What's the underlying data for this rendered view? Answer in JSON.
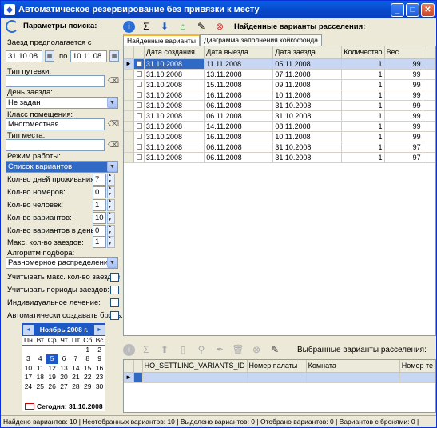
{
  "window": {
    "title": "Автоматическое резервирование без привязки к месту"
  },
  "left": {
    "header": "Параметры поиска:",
    "arrival_label": "Заезд предполагается с",
    "date_from": "31.10.08",
    "po_label": "по",
    "date_to": "10.11.08",
    "voucher_label": "Тип путевки:",
    "voucher_value": "",
    "arrival_day_label": "День заезда:",
    "arrival_day_value": "Не задан",
    "room_class_label": "Класс помещения:",
    "room_class_value": "Многоместная",
    "place_type_label": "Тип места:",
    "place_type_value": "",
    "mode_label": "Режим работы:",
    "mode_value": "Список вариантов",
    "params": [
      {
        "label": "Кол-во дней проживания:",
        "value": "7"
      },
      {
        "label": "Кол-во номеров:",
        "value": "0"
      },
      {
        "label": "Кол-во человек:",
        "value": "1"
      },
      {
        "label": "Кол-во вариантов:",
        "value": "10"
      },
      {
        "label": "Кол-во вариантов в день:",
        "value": "0"
      },
      {
        "label": "Макс. кол-во заездов:",
        "value": "1"
      }
    ],
    "algo_label": "Алгоритм подбора:",
    "algo_value": "Равномерное распределение",
    "checkboxes": [
      "Учитывать макс. кол-во заездов:",
      "Учитывать периоды заездов:",
      "Индивидуальное лечение:",
      "Автоматически создавать бронь:"
    ]
  },
  "calendar": {
    "month": "Ноябрь 2008 г.",
    "dow": [
      "Пн",
      "Вт",
      "Ср",
      "Чт",
      "Пт",
      "Сб",
      "Вс"
    ],
    "days": [
      "",
      "",
      "",
      "",
      "",
      "1",
      "2",
      "3",
      "4",
      "5",
      "6",
      "7",
      "8",
      "9",
      "10",
      "11",
      "12",
      "13",
      "14",
      "15",
      "16",
      "17",
      "18",
      "19",
      "20",
      "21",
      "22",
      "23",
      "24",
      "25",
      "26",
      "27",
      "28",
      "29",
      "30",
      "",
      "",
      "",
      "",
      "",
      "",
      ""
    ],
    "today_label": "Сегодня: 31.10.2008"
  },
  "right": {
    "found_title": "Найденные варианты расселения:",
    "tab1": "Найденные варианты",
    "tab2": "Диаграмма заполнения койкофонда",
    "columns": [
      "Дата создания",
      "Дата выезда",
      "Дата заезда",
      "Количество",
      "Вес"
    ],
    "rows": [
      [
        "31.10.2008",
        "11.11.2008",
        "05.11.2008",
        "1",
        "99"
      ],
      [
        "31.10.2008",
        "13.11.2008",
        "07.11.2008",
        "1",
        "99"
      ],
      [
        "31.10.2008",
        "15.11.2008",
        "09.11.2008",
        "1",
        "99"
      ],
      [
        "31.10.2008",
        "16.11.2008",
        "10.11.2008",
        "1",
        "99"
      ],
      [
        "31.10.2008",
        "06.11.2008",
        "31.10.2008",
        "1",
        "99"
      ],
      [
        "31.10.2008",
        "06.11.2008",
        "31.10.2008",
        "1",
        "99"
      ],
      [
        "31.10.2008",
        "14.11.2008",
        "08.11.2008",
        "1",
        "99"
      ],
      [
        "31.10.2008",
        "16.11.2008",
        "10.11.2008",
        "1",
        "99"
      ],
      [
        "31.10.2008",
        "06.11.2008",
        "31.10.2008",
        "1",
        "97"
      ],
      [
        "31.10.2008",
        "06.11.2008",
        "31.10.2008",
        "1",
        "97"
      ]
    ],
    "selected_title": "Выбранные варианты расселения:",
    "sel_columns": [
      "HO_SETTLING_VARIANTS_ID",
      "Номер палаты",
      "Комната",
      "Номер те"
    ]
  },
  "status": "Найдено вариантов: 10 | Неотобранных вариантов: 10 | Выделено вариантов: 0 | Отобрано вариантов: 0 | Вариантов с бронями: 0 |"
}
